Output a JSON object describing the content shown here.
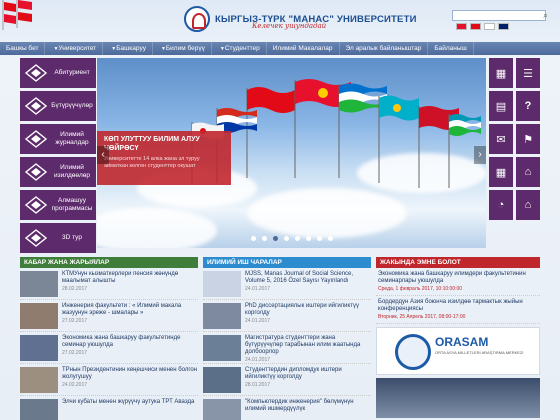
{
  "header": {
    "title": "КЫРГЫЗ-ТҮРК \"МАНАС\" УНИВЕРСИТЕТИ",
    "slogan": "Келечек ушундадай",
    "search_placeholder": ""
  },
  "languages": [
    {
      "name": "kg-flag-icon",
      "color": "#e8112d"
    },
    {
      "name": "tr-flag-icon",
      "color": "#e30a17"
    },
    {
      "name": "ru-flag-icon",
      "color": "#ffffff"
    },
    {
      "name": "en-flag-icon",
      "color": "#012169"
    }
  ],
  "nav": [
    {
      "label": "Башкы бет",
      "caret": false
    },
    {
      "label": "Университет",
      "caret": true
    },
    {
      "label": "Башкаруу",
      "caret": true
    },
    {
      "label": "Билим берүү",
      "caret": true
    },
    {
      "label": "Студенттер",
      "caret": true
    },
    {
      "label": "Илимий Макалалар",
      "caret": false
    },
    {
      "label": "Эл аралык байланыштар",
      "caret": false
    },
    {
      "label": "Байланыш",
      "caret": false
    }
  ],
  "left_tiles": [
    {
      "label": "Абитуриент"
    },
    {
      "label": "Бүтүрүүчүлөр"
    },
    {
      "label": "Илимий журналдар"
    },
    {
      "label": "Илимий изилдөөлөр"
    },
    {
      "label": "Алмашуу программасы"
    },
    {
      "label": "3D тур"
    }
  ],
  "slider": {
    "title": "КӨП УЛУТТУУ БИЛИМ АЛУУ ЧӨЙРӨСҮ",
    "text": "Университетте 14 алка жана эл туруу айматкан келген студенттер окушат"
  },
  "right_tiles": [
    "▦",
    "☰",
    "▤",
    "?",
    "✉",
    "⚑",
    "▦",
    "⌂",
    "◔",
    "⌂"
  ],
  "columns": {
    "news": {
      "title": "КАБАР ЖАНА ЖАРЫЯЛАР",
      "items": [
        {
          "text": "КТМУнун кызматкерлери пенсия жөнүндө маалымат алышты",
          "date": "28.02.2017"
        },
        {
          "text": "Инженерия факультети : « Илимий макала жазуунун эрежe - шмалары »",
          "date": "27.02.2017"
        },
        {
          "text": "Экономика жана башкаруу факультетинде семинар уюшулда",
          "date": "27.02.2017"
        },
        {
          "text": "ТРнын Президентинин кеңешчиси менен болгон жолугушуу",
          "date": "24.02.2017"
        },
        {
          "text": "Элчи кубаты менен жүрүүчү аутука ТРТ Авазда",
          "date": ""
        }
      ]
    },
    "research": {
      "title": "ИЛИМИЙ ИШ ЧАРАЛАР",
      "items": [
        {
          "text": "MJSS, Manas Journal of Social Science, Volume 5, 2016 Özel Sayısı Yayınlandı",
          "date": "24.01.2017"
        },
        {
          "text": "PhD диссертациялык иштери ийгиликтүү корголду",
          "date": "24.01.2017"
        },
        {
          "text": "Магистратура студенттери жана бүтүрүүчүлөр тарабынан илим жаатында долбоорлор",
          "date": "24.01.2017"
        },
        {
          "text": "Студенттердин дипломдук иштери ийгиликтүү корголду",
          "date": "28.01.2017"
        },
        {
          "text": "\"Компьютердик инженерия\" бөлүмүнүн илимий ишмердүүлүк",
          "date": ""
        }
      ]
    },
    "events": {
      "title": "ЖАКЫНДА ЭМНЕ БОЛОТ",
      "items": [
        {
          "text": "Экономика жана башкаруу илимдери факультетинин семинарлары уюшулда",
          "date": "Среда, 1 февраль 2017, 10:10:00:00"
        },
        {
          "text": "Бордердун Азия боюнча изилдөө тармактык жыйын конференциясы",
          "date": "Вторник, 25 Апрель 2017, 08:00-17:00"
        }
      ],
      "banner": {
        "title": "ORASAM",
        "sub": "ORTA ASYA MILLETLERİ ARAŞTIRMA MERKEZİ"
      }
    }
  }
}
